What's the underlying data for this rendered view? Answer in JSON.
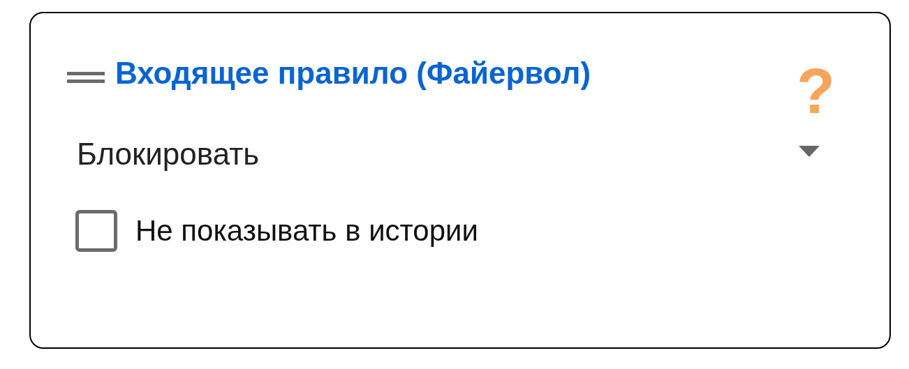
{
  "card": {
    "title": "Входящее правило (Файервол)",
    "help": "?",
    "dropdown": {
      "value": "Блокировать"
    },
    "checkbox": {
      "label": "Не показывать в истории",
      "checked": false
    }
  }
}
